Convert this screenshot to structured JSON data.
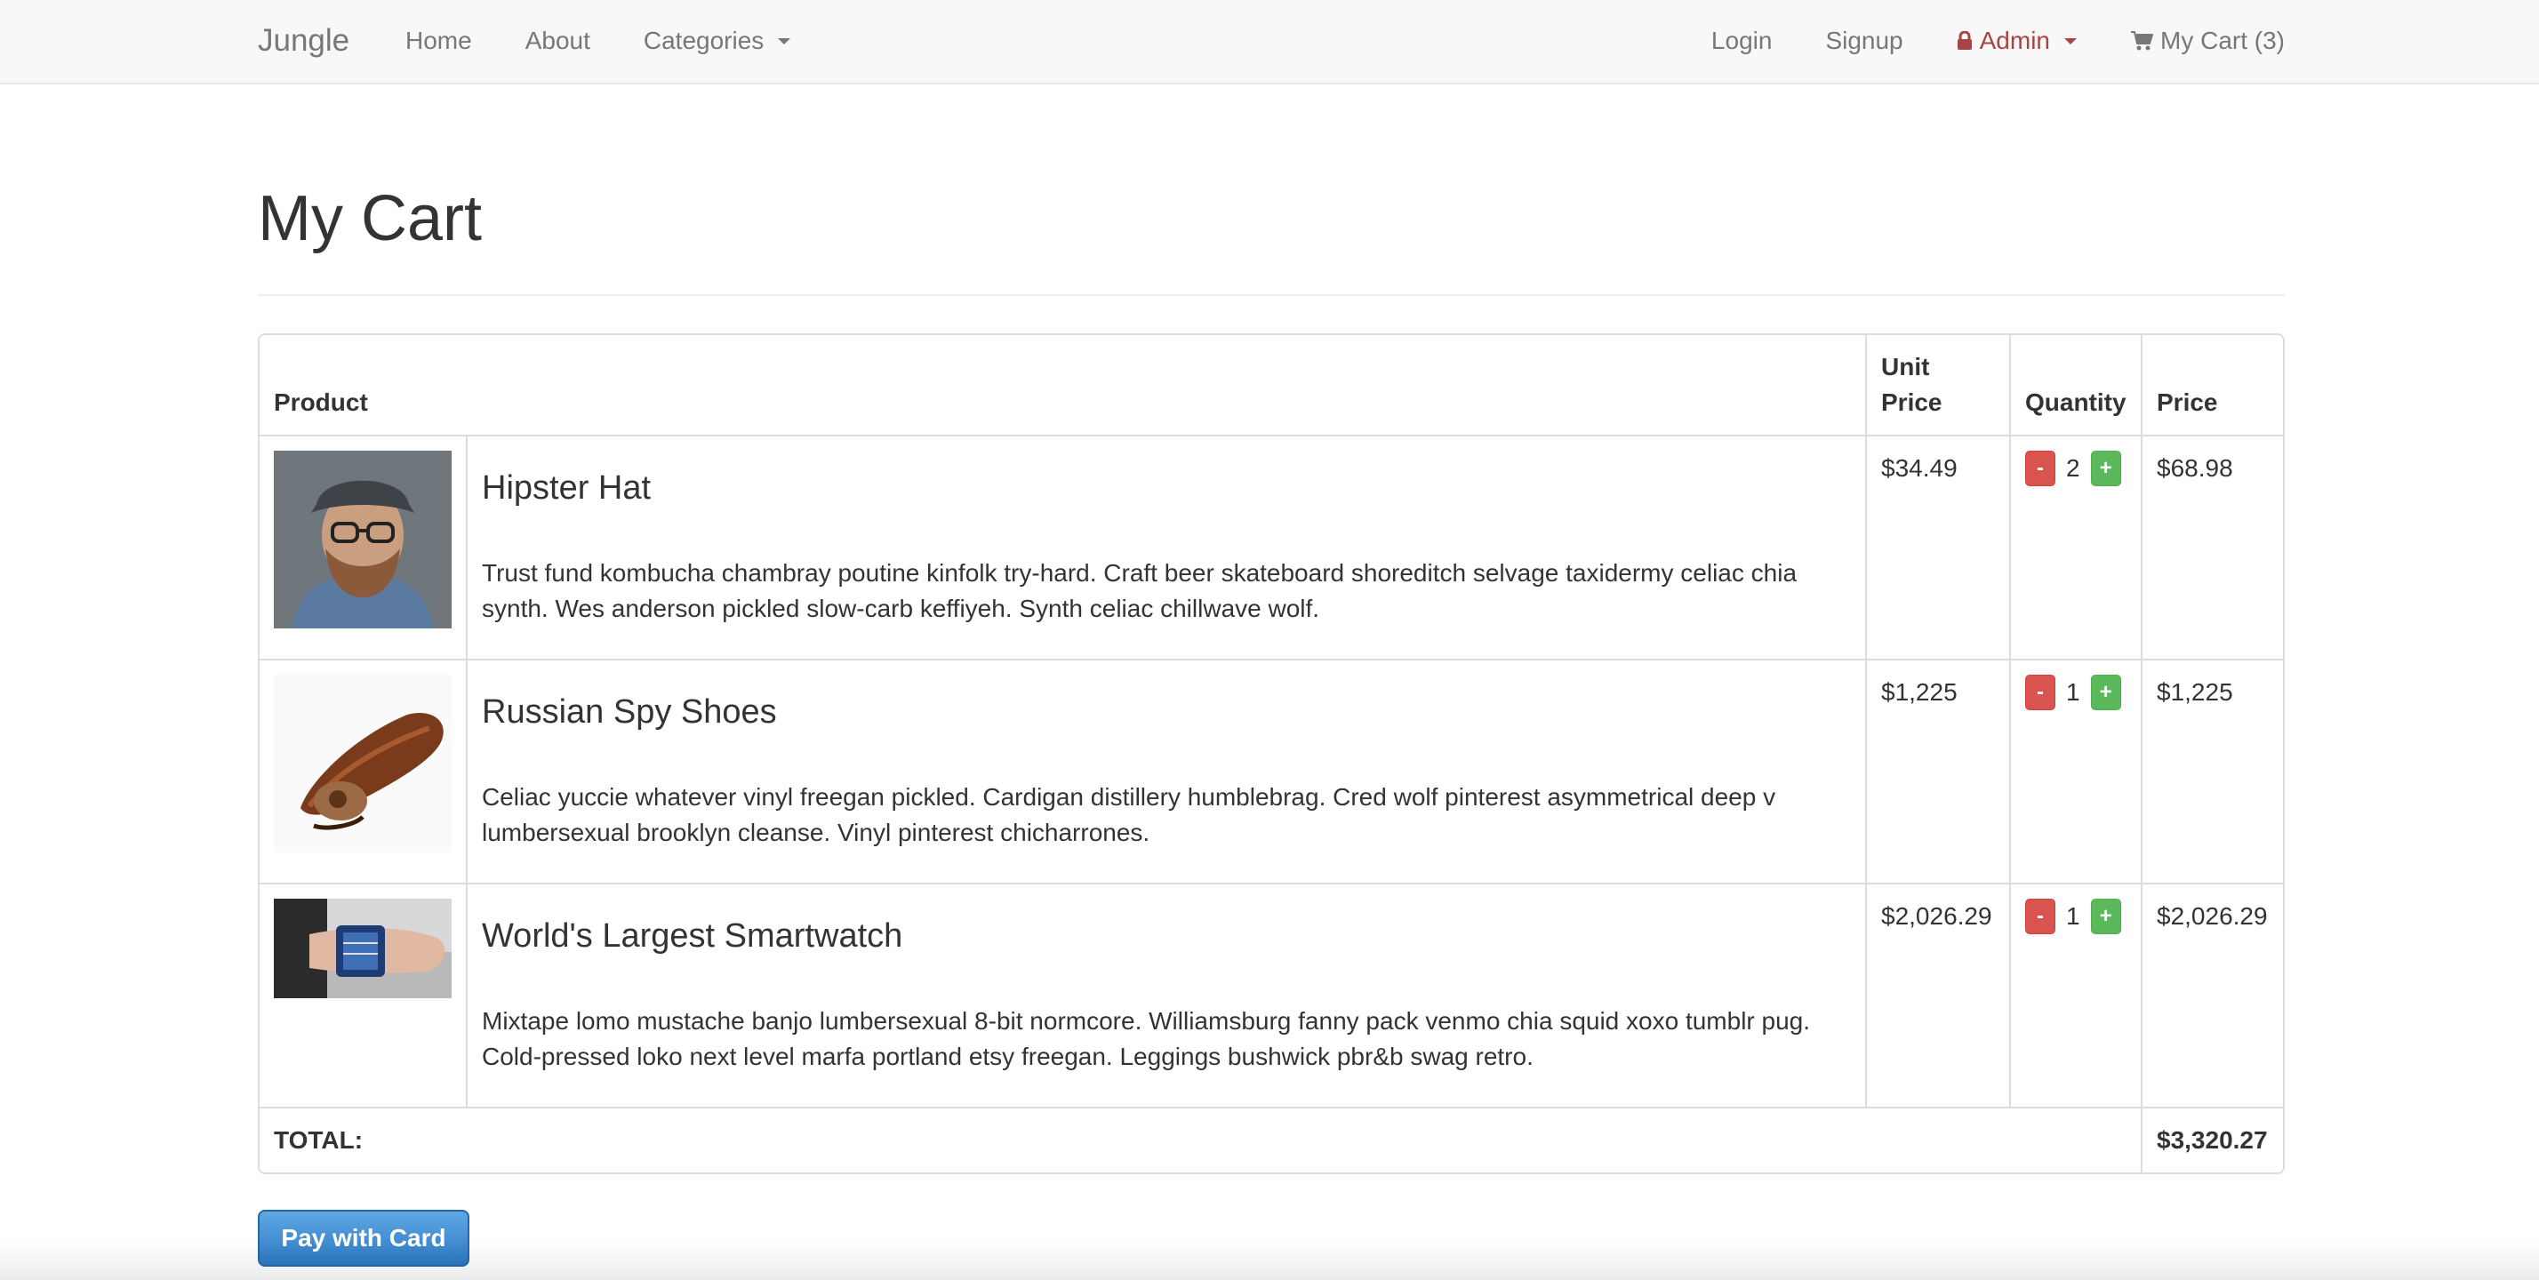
{
  "navbar": {
    "brand": "Jungle",
    "left_links": [
      "Home",
      "About",
      "Categories"
    ],
    "right_links": {
      "login": "Login",
      "signup": "Signup",
      "admin": "Admin",
      "cart": "My Cart (3)"
    }
  },
  "page": {
    "title": "My Cart"
  },
  "table": {
    "headers": {
      "product": "Product",
      "unit_price": "Unit Price",
      "quantity": "Quantity",
      "price": "Price"
    },
    "items": [
      {
        "name": "Hipster Hat",
        "description": "Trust fund kombucha chambray poutine kinfolk try-hard. Craft beer skateboard shoreditch selvage taxidermy celiac chia synth. Wes anderson pickled slow-carb keffiyeh. Synth celiac chillwave wolf.",
        "unit_price": "$34.49",
        "quantity": "2",
        "price": "$68.98"
      },
      {
        "name": "Russian Spy Shoes",
        "description": "Celiac yuccie whatever vinyl freegan pickled. Cardigan distillery humblebrag. Cred wolf pinterest asymmetrical deep v lumbersexual brooklyn cleanse. Vinyl pinterest chicharrones.",
        "unit_price": "$1,225",
        "quantity": "1",
        "price": "$1,225"
      },
      {
        "name": "World's Largest Smartwatch",
        "description": "Mixtape lomo mustache banjo lumbersexual 8-bit normcore. Williamsburg fanny pack venmo chia squid xoxo tumblr pug. Cold-pressed loko next level marfa portland etsy freegan. Leggings bushwick pbr&b swag retro.",
        "unit_price": "$2,026.29",
        "quantity": "1",
        "price": "$2,026.29"
      }
    ],
    "minus_label": "-",
    "plus_label": "+",
    "total_label": "TOTAL:",
    "total_value": "$3,320.27"
  },
  "actions": {
    "pay_button": "Pay with Card"
  },
  "colors": {
    "navbar_bg": "#f8f8f8",
    "admin_red": "#a94442",
    "btn_danger": "#d9534f",
    "btn_success": "#5cb85c",
    "pay_blue": "#3c8fd9"
  },
  "icons": [
    "lock-icon",
    "cart-icon",
    "caret-down-icon"
  ]
}
